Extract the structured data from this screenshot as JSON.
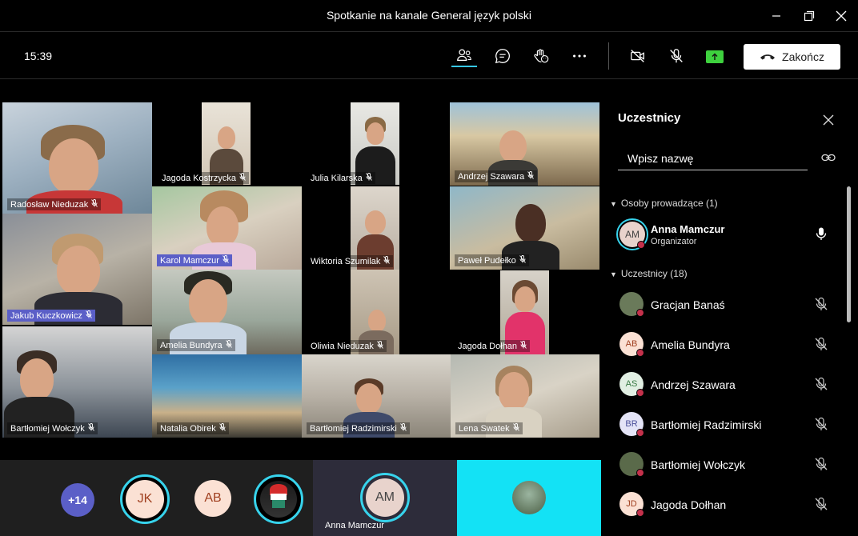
{
  "window": {
    "title": "Spotkanie na kanale General język polski"
  },
  "toolbar": {
    "clock": "15:39",
    "hangup_label": "Zakończ"
  },
  "grid": [
    {
      "name": "Radosław Nieduzak"
    },
    {
      "name": "Jagoda Kostrzycka"
    },
    {
      "name": "Julia Kilarska"
    },
    {
      "name": "Andrzej Szawara"
    },
    {
      "name": "Karol Mamczur"
    },
    {
      "name": "Wiktoria Szumilak"
    },
    {
      "name": "Paweł Pudełko"
    },
    {
      "name": "Jakub Kuczkowicz"
    },
    {
      "name": "Amelia Bundyra"
    },
    {
      "name": "Oliwia Nieduzak"
    },
    {
      "name": "Jagoda Dołhan"
    },
    {
      "name": "Bartłomiej Wołczyk"
    },
    {
      "name": "Natalia Obirek"
    },
    {
      "name": "Bartłomiej Radzimirski"
    },
    {
      "name": "Lena Swatek"
    }
  ],
  "strip": {
    "more_count": "+14",
    "avatars": [
      "JK",
      "AB",
      "AM"
    ],
    "pinned_name": "Anna Mamczur"
  },
  "panel": {
    "title": "Uczestnicy",
    "search_placeholder": "Wpisz nazwę",
    "presenters_header": "Osoby prowadzące (1)",
    "organizer": {
      "initials": "AM",
      "name": "Anna Mamczur",
      "role": "Organizator"
    },
    "attendees_header": "Uczestnicy (18)",
    "attendees": [
      {
        "initials": "",
        "name": "Gracjan Banaś",
        "color": "#6a7a5a"
      },
      {
        "initials": "AB",
        "name": "Amelia Bundyra",
        "color": "#fbe1d4"
      },
      {
        "initials": "AS",
        "name": "Andrzej Szawara",
        "color": "#e1efe3"
      },
      {
        "initials": "BR",
        "name": "Bartłomiej Radzimirski",
        "color": "#e4e4f7"
      },
      {
        "initials": "",
        "name": "Bartłomiej Wołczyk",
        "color": "#5a6a4a"
      },
      {
        "initials": "JD",
        "name": "Jagoda Dołhan",
        "color": "#fbe1d4"
      }
    ]
  },
  "colors": {
    "accent": "#37c8e8",
    "presence_red": "#c4314b",
    "share_green": "#3ed13e",
    "spotlight": "#13e2f5"
  }
}
